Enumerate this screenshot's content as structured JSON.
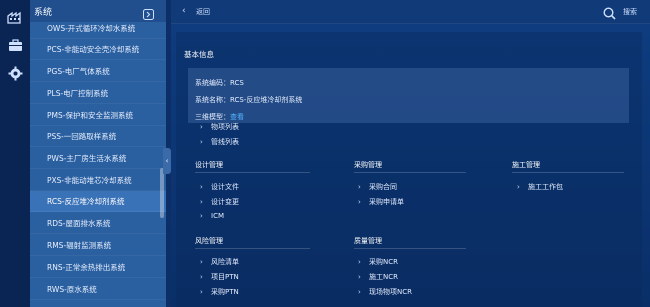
{
  "rail": {
    "icons": [
      "factory-icon",
      "briefcase-icon",
      "settings-gear-icon"
    ]
  },
  "sidebar": {
    "title": "系统",
    "items": [
      {
        "label": "OWS-开式循环冷却水系统"
      },
      {
        "label": "PCS-非能动安全壳冷却系统"
      },
      {
        "label": "PGS-电厂气体系统"
      },
      {
        "label": "PLS-电厂控制系统"
      },
      {
        "label": "PMS-保护和安全监测系统"
      },
      {
        "label": "PSS-一回路取样系统"
      },
      {
        "label": "PWS-主厂房生活水系统"
      },
      {
        "label": "PXS-非能动堆芯冷却系统"
      },
      {
        "label": "RCS-反应堆冷却剂系统"
      },
      {
        "label": "RDS-屋面排水系统"
      },
      {
        "label": "RMS-辐射监测系统"
      },
      {
        "label": "RNS-正常余热排出系统"
      },
      {
        "label": "RWS-原水系统"
      }
    ],
    "active_index": 8,
    "toggle_glyph": "‹"
  },
  "topbar": {
    "back_label": "返回",
    "search_label": "搜索"
  },
  "basic_info": {
    "title": "基本信息",
    "system_code_label": "系统编码：",
    "system_code": "RCS",
    "system_name_label": "系统名称：",
    "system_name": "RCS-反应堆冷却剂系统",
    "model_label": "三维模型：",
    "model_link": "查看",
    "sub_links": [
      "物项列表",
      "管线列表"
    ]
  },
  "groups": {
    "design": {
      "title": "设计管理",
      "links": [
        "设计文件",
        "设计变更",
        "ICM"
      ]
    },
    "procurement": {
      "title": "采购管理",
      "links": [
        "采购合同",
        "采购申请单"
      ]
    },
    "construction": {
      "title": "施工管理",
      "links": [
        "施工工作包"
      ]
    },
    "risk": {
      "title": "风险管理",
      "links": [
        "风险清单",
        "项目PTN",
        "采购PTN"
      ]
    },
    "quality": {
      "title": "质量管理",
      "links": [
        "采购NCR",
        "施工NCR",
        "现场物项NCR"
      ]
    }
  },
  "colors": {
    "link": "#55b5ff",
    "sidebar_bg": "#2a5fa0",
    "main_bg": "#0b2f66"
  }
}
